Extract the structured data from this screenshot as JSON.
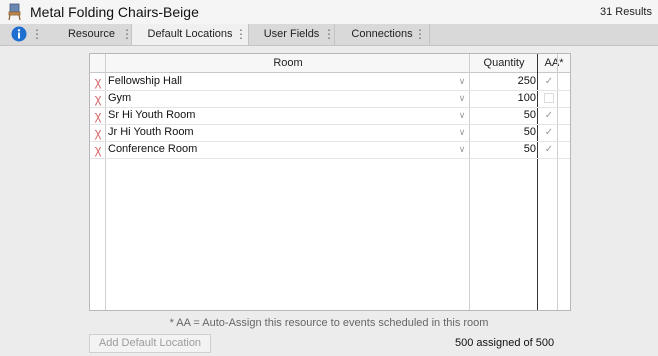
{
  "window": {
    "title": "Metal Folding Chairs-Beige",
    "results": "31 Results",
    "app_icon": "chair-icon"
  },
  "tabs": [
    {
      "label": "Resource",
      "active": false
    },
    {
      "label": "Default Locations",
      "active": true
    },
    {
      "label": "User Fields",
      "active": false
    },
    {
      "label": "Connections",
      "active": false
    }
  ],
  "grid": {
    "headers": {
      "room": "Room",
      "quantity": "Quantity",
      "aa": "AA*"
    },
    "rows": [
      {
        "room": "Fellowship Hall",
        "quantity": "250",
        "aa": true
      },
      {
        "room": "Gym",
        "quantity": "100",
        "aa": false
      },
      {
        "room": "Sr Hi Youth Room",
        "quantity": "50",
        "aa": true
      },
      {
        "room": "Jr Hi Youth Room",
        "quantity": "50",
        "aa": true
      },
      {
        "room": "Conference Room",
        "quantity": "50",
        "aa": true
      }
    ]
  },
  "footer": {
    "note": "* AA = Auto-Assign this resource to events scheduled in this room",
    "add_button": "Add Default Location",
    "assigned": "500 assigned of 500"
  },
  "colors": {
    "delete_icon": "#d86868",
    "info_icon": "#1f6fd1",
    "active_tab": "#f0f0f0"
  }
}
